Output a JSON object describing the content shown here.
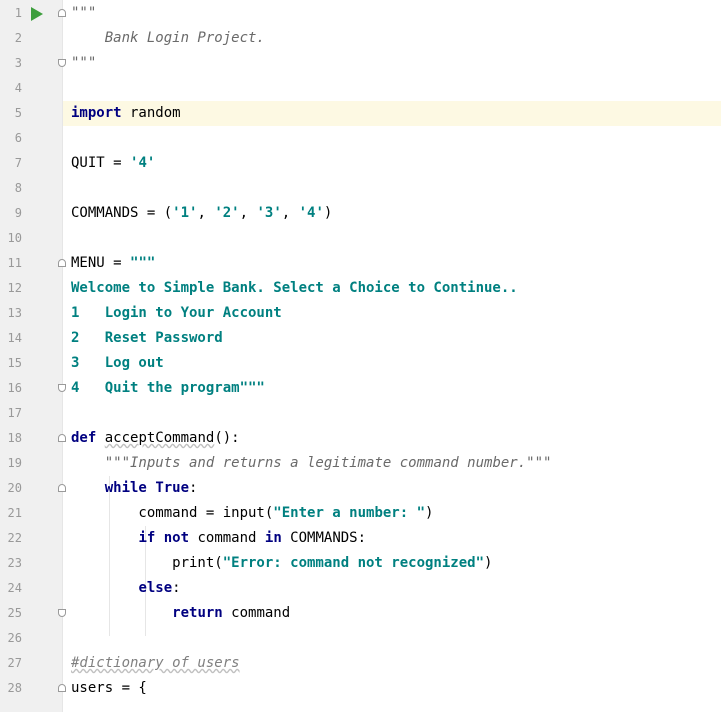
{
  "editor": {
    "lines": [
      {
        "n": "1",
        "tokens": [
          {
            "t": "\"\"\"",
            "c": "doc"
          }
        ]
      },
      {
        "n": "2",
        "tokens": [
          {
            "t": "    Bank Login Project.",
            "c": "doc"
          }
        ]
      },
      {
        "n": "3",
        "tokens": [
          {
            "t": "\"\"\"",
            "c": "doc"
          }
        ]
      },
      {
        "n": "4",
        "tokens": []
      },
      {
        "n": "5",
        "tokens": [
          {
            "t": "import",
            "c": "kw"
          },
          {
            "t": " random",
            "c": ""
          }
        ]
      },
      {
        "n": "6",
        "tokens": []
      },
      {
        "n": "7",
        "tokens": [
          {
            "t": "QUIT = ",
            "c": ""
          },
          {
            "t": "'4'",
            "c": "str"
          }
        ]
      },
      {
        "n": "8",
        "tokens": []
      },
      {
        "n": "9",
        "tokens": [
          {
            "t": "COMMANDS = (",
            "c": ""
          },
          {
            "t": "'1'",
            "c": "str"
          },
          {
            "t": ", ",
            "c": ""
          },
          {
            "t": "'2'",
            "c": "str"
          },
          {
            "t": ", ",
            "c": ""
          },
          {
            "t": "'3'",
            "c": "str"
          },
          {
            "t": ", ",
            "c": ""
          },
          {
            "t": "'4'",
            "c": "str"
          },
          {
            "t": ")",
            "c": ""
          }
        ]
      },
      {
        "n": "10",
        "tokens": []
      },
      {
        "n": "11",
        "tokens": [
          {
            "t": "MENU = ",
            "c": ""
          },
          {
            "t": "\"\"\"",
            "c": "str"
          }
        ]
      },
      {
        "n": "12",
        "tokens": [
          {
            "t": "Welcome to Simple Bank. Select a Choice to Continue..",
            "c": "str"
          }
        ]
      },
      {
        "n": "13",
        "tokens": [
          {
            "t": "1   Login to Your Account",
            "c": "str"
          }
        ]
      },
      {
        "n": "14",
        "tokens": [
          {
            "t": "2   Reset Password",
            "c": "str"
          }
        ]
      },
      {
        "n": "15",
        "tokens": [
          {
            "t": "3   Log out",
            "c": "str"
          }
        ]
      },
      {
        "n": "16",
        "tokens": [
          {
            "t": "4   Quit the program\"\"\"",
            "c": "str"
          }
        ]
      },
      {
        "n": "17",
        "tokens": []
      },
      {
        "n": "18",
        "tokens": [
          {
            "t": "def",
            "c": "kw"
          },
          {
            "t": " ",
            "c": ""
          },
          {
            "t": "acceptCommand",
            "c": "wavy"
          },
          {
            "t": "():",
            "c": ""
          }
        ]
      },
      {
        "n": "19",
        "tokens": [
          {
            "t": "    ",
            "c": ""
          },
          {
            "t": "\"\"\"Inputs and returns a legitimate command number.\"\"\"",
            "c": "doc"
          }
        ]
      },
      {
        "n": "20",
        "tokens": [
          {
            "t": "    ",
            "c": ""
          },
          {
            "t": "while",
            "c": "kw"
          },
          {
            "t": " ",
            "c": ""
          },
          {
            "t": "True",
            "c": "kw"
          },
          {
            "t": ":",
            "c": ""
          }
        ]
      },
      {
        "n": "21",
        "tokens": [
          {
            "t": "        command = input(",
            "c": ""
          },
          {
            "t": "\"Enter a number: \"",
            "c": "str"
          },
          {
            "t": ")",
            "c": ""
          }
        ]
      },
      {
        "n": "22",
        "tokens": [
          {
            "t": "        ",
            "c": ""
          },
          {
            "t": "if",
            "c": "kw"
          },
          {
            "t": " ",
            "c": ""
          },
          {
            "t": "not",
            "c": "kw"
          },
          {
            "t": " command ",
            "c": ""
          },
          {
            "t": "in",
            "c": "kw"
          },
          {
            "t": " COMMANDS:",
            "c": ""
          }
        ]
      },
      {
        "n": "23",
        "tokens": [
          {
            "t": "            print(",
            "c": ""
          },
          {
            "t": "\"Error: command not recognized\"",
            "c": "str"
          },
          {
            "t": ")",
            "c": ""
          }
        ]
      },
      {
        "n": "24",
        "tokens": [
          {
            "t": "        ",
            "c": ""
          },
          {
            "t": "else",
            "c": "kw"
          },
          {
            "t": ":",
            "c": ""
          }
        ]
      },
      {
        "n": "25",
        "tokens": [
          {
            "t": "            ",
            "c": ""
          },
          {
            "t": "return",
            "c": "kw"
          },
          {
            "t": " command",
            "c": ""
          }
        ]
      },
      {
        "n": "26",
        "tokens": []
      },
      {
        "n": "27",
        "tokens": [
          {
            "t": "#dictionary of users",
            "c": "cmt wavy"
          }
        ]
      },
      {
        "n": "28",
        "tokens": [
          {
            "t": "users = {",
            "c": ""
          }
        ]
      }
    ]
  }
}
